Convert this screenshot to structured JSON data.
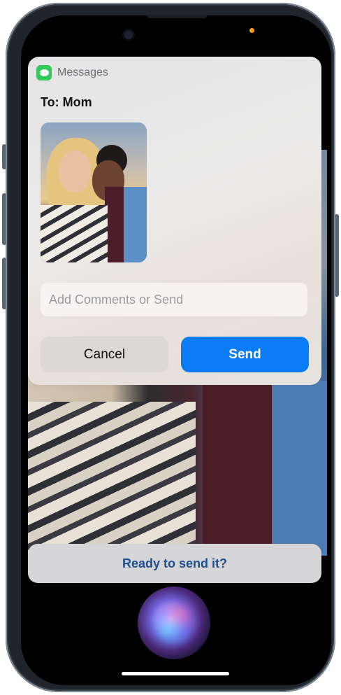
{
  "messages_card": {
    "app_name": "Messages",
    "app_icon": "messages-bubble-icon",
    "recipient_line": "To: Mom",
    "attachment": "photo-thumbnail",
    "comment_placeholder": "Add Comments or Send",
    "comment_value": "",
    "cancel_label": "Cancel",
    "send_label": "Send"
  },
  "siri": {
    "prompt": "Ready to send it?",
    "orb_icon": "siri-orb-icon"
  },
  "colors": {
    "send_button": "#0a7cf5",
    "messages_icon": "#34c759",
    "prompt_text": "#1d4f8f",
    "recording_indicator": "#ff9f0a"
  }
}
